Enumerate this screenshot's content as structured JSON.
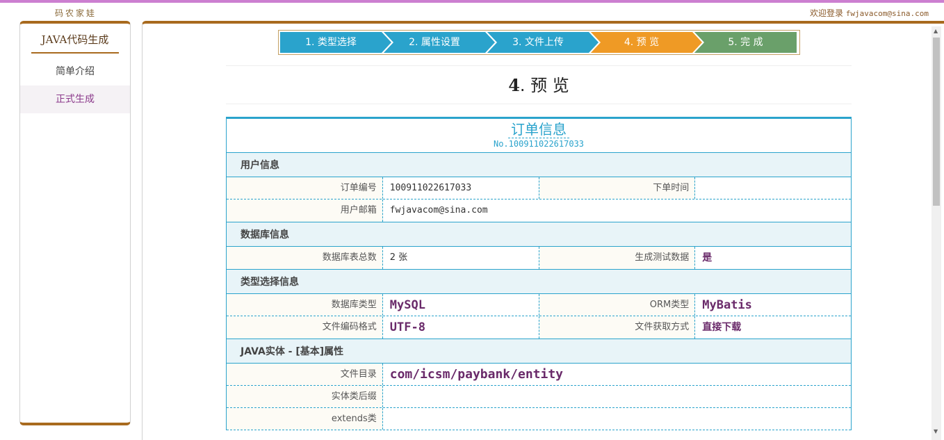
{
  "header": {
    "brand": "码农家娃",
    "welcome": "欢迎登录",
    "email": "fwjavacom@sina.com"
  },
  "sidebar": {
    "title": "JAVA代码生成",
    "items": [
      {
        "label": "简单介绍",
        "active": false
      },
      {
        "label": "正式生成",
        "active": true
      }
    ]
  },
  "steps": [
    {
      "label": "1. 类型选择",
      "state": "done"
    },
    {
      "label": "2. 属性设置",
      "state": "done"
    },
    {
      "label": "3. 文件上传",
      "state": "done"
    },
    {
      "label": "4. 预 览",
      "state": "current"
    },
    {
      "label": "5. 完 成",
      "state": "todo"
    }
  ],
  "preview": {
    "num": "4",
    "title": ". 预 览"
  },
  "order": {
    "title": "订单信息",
    "no": "No.100911022617033",
    "sections": {
      "user": "用户信息",
      "db": "数据库信息",
      "type": "类型选择信息",
      "entity": "JAVA实体 - [基本]属性"
    },
    "fields": {
      "order_no_label": "订单编号",
      "order_no": "100911022617033",
      "order_time_label": "下单时间",
      "order_time": "",
      "email_label": "用户邮箱",
      "email": "fwjavacom@sina.com",
      "tables_label": "数据库表总数",
      "tables": "2 张",
      "test_data_label": "生成测试数据",
      "test_data": "是",
      "db_type_label": "数据库类型",
      "db_type": "MySQL",
      "orm_label": "ORM类型",
      "orm": "MyBatis",
      "encoding_label": "文件编码格式",
      "encoding": "UTF-8",
      "fetch_label": "文件获取方式",
      "fetch": "直接下载",
      "dir_label": "文件目录",
      "dir": "com/icsm/paybank/entity",
      "suffix_label": "实体类后缀",
      "suffix": "",
      "extends_label": "extends类",
      "extends": ""
    }
  },
  "colors": {
    "accent_blue": "#2aa3cc",
    "accent_orange": "#ef9a25",
    "accent_green": "#6aa06a",
    "brown": "#a86a1e"
  }
}
